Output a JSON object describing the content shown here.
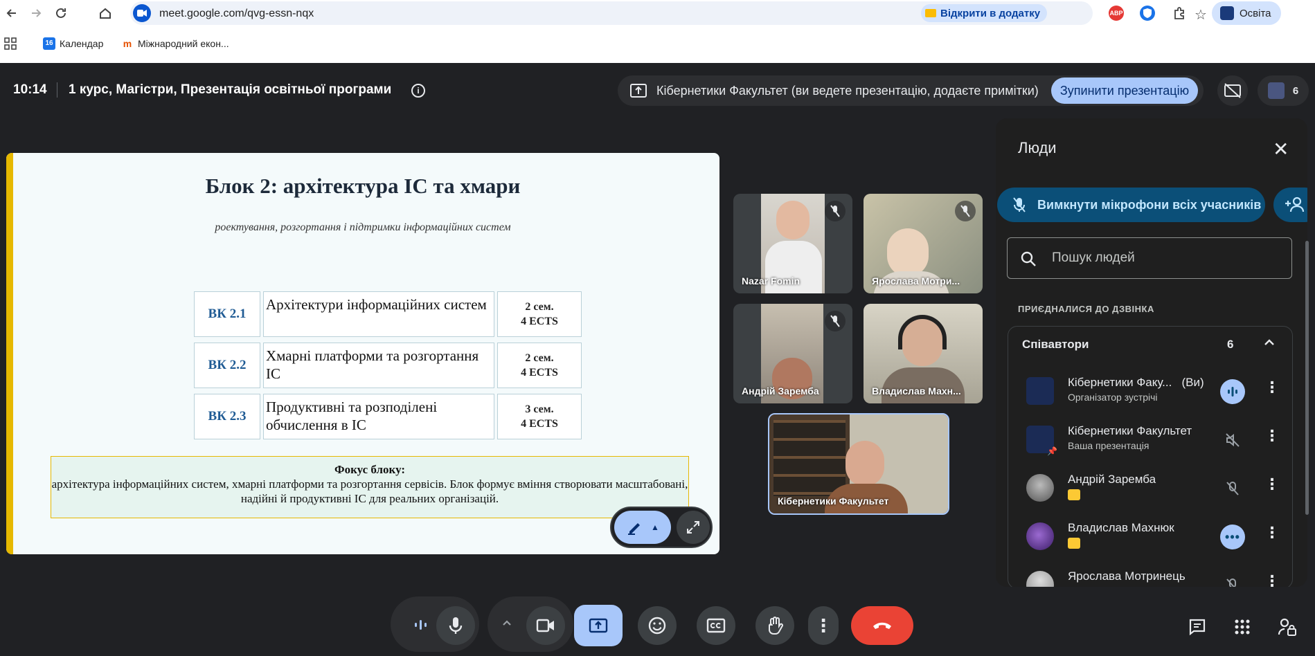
{
  "browser": {
    "url": "meet.google.com/qvg-essn-nqx",
    "open_in_app": "Відкрити в додатку",
    "profile_label": "Освіта",
    "bookmarks": [
      {
        "badge": "16",
        "label": "Календар"
      },
      {
        "badge": "m",
        "label": "Міжнародний екон..."
      }
    ],
    "ext_abp": "ABP"
  },
  "meet": {
    "time": "10:14",
    "title": "1 курс, Магістри, Презентація освітньої програми",
    "presenting_text": "Кібернетики Факультет (ви ведете презентацію, додаєте примітки)",
    "stop_label": "Зупинити презентацію",
    "participants_count": "6"
  },
  "slide": {
    "title": "Блок 2: архітектура ІС та хмари",
    "subtitle": "роектування, розгортання і підтримки інформаційних систем",
    "rows": [
      {
        "code": "ВК 2.1",
        "name": "Архітектури інформаційних систем",
        "sem": "2 сем.",
        "ects": "4 ECTS"
      },
      {
        "code": "ВК 2.2",
        "name": "Хмарні платформи та розгортання ІС",
        "sem": "2 сем.",
        "ects": "4 ECTS"
      },
      {
        "code": "ВК 2.3",
        "name": "Продуктивні та розподілені обчислення в ІС",
        "sem": "3 сем.",
        "ects": "4 ECTS"
      }
    ],
    "focus_title": "Фокус блоку:",
    "focus_text": "архітектура інформаційних систем, хмарні платформи та розгортання сервісів. Блок формує вміння створювати масштабовані, надійні й продуктивні ІС для реальних організацій."
  },
  "tiles": [
    {
      "name": "Nazar Fomin",
      "muted": true
    },
    {
      "name": "Ярослава Мотри...",
      "muted": true
    },
    {
      "name": "Андрій Заремба",
      "muted": true
    },
    {
      "name": "Владислав Махн...",
      "muted": false
    },
    {
      "name": "Кібернетики Факультет",
      "muted": false
    }
  ],
  "people": {
    "title": "Люди",
    "mute_all": "Вимкнути мікрофони всіх учасників",
    "search_placeholder": "Пошук людей",
    "joined_label": "ПРИЄДНАЛИСЯ ДО ДЗВІНКА",
    "group_label": "Співавтори",
    "group_count": "6",
    "list": [
      {
        "name": "Кібернетики Факу...",
        "tag": "(Ви)",
        "role": "Організатор зустрічі",
        "state": "speaking"
      },
      {
        "name": "Кібернетики Факультет",
        "tag": "",
        "role": "Ваша презентація",
        "state": "muted-sound"
      },
      {
        "name": "Андрій Заремба",
        "tag": "",
        "role": "",
        "state": "muted"
      },
      {
        "name": "Владислав Махнюк",
        "tag": "",
        "role": "",
        "state": "more"
      },
      {
        "name": "Ярослава Мотринець",
        "tag": "",
        "role": "",
        "state": "muted"
      }
    ]
  },
  "colors": {
    "accent": "#a8c7fa",
    "end_call": "#ea4335",
    "slide_accent": "#e6b800",
    "mute_all_bg": "#0b4f78"
  }
}
